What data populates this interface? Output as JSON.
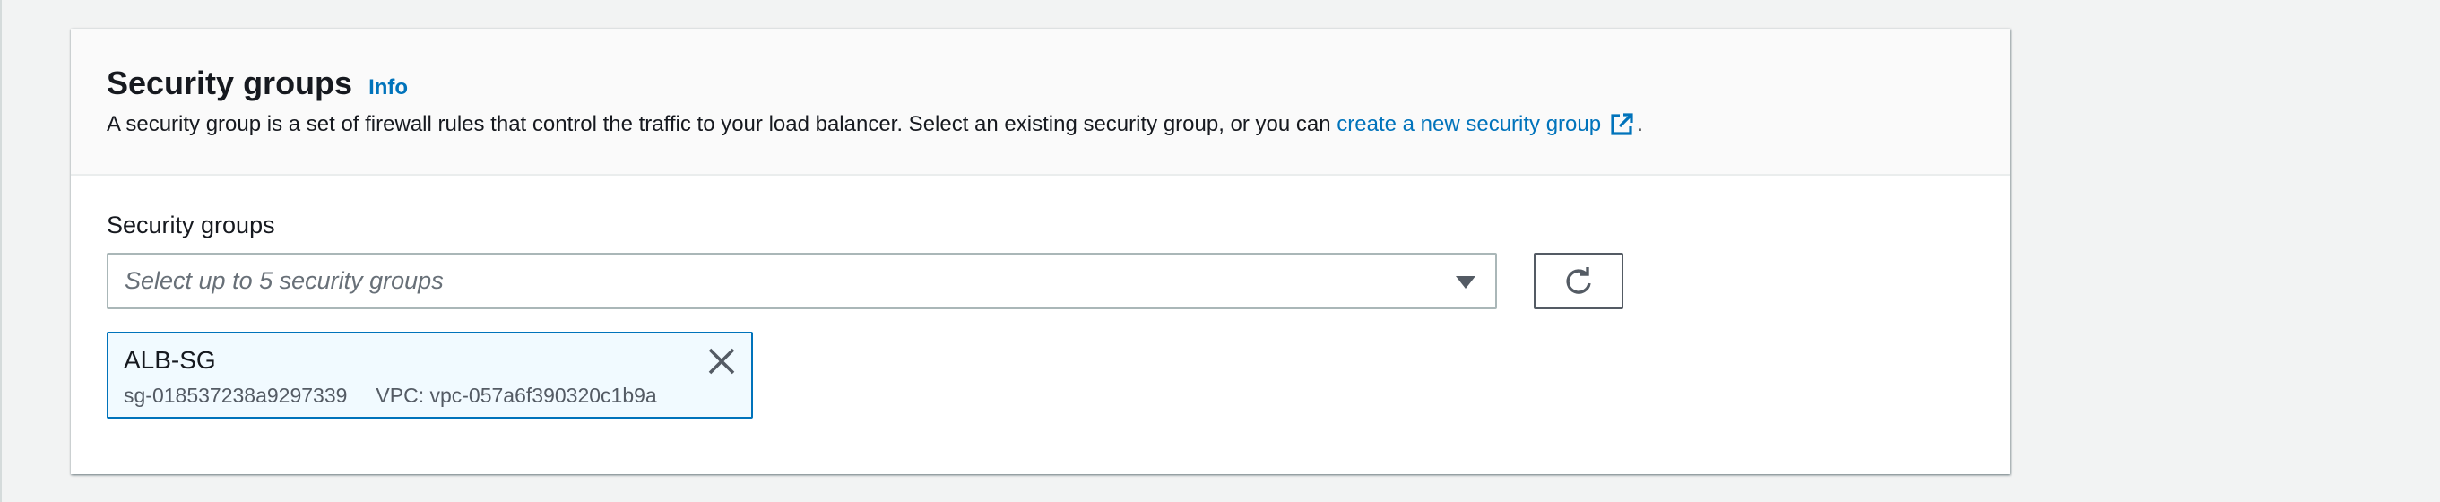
{
  "section": {
    "title": "Security groups",
    "info_label": "Info",
    "description_prefix": "A security group is a set of firewall rules that control the traffic to your load balancer. Select an existing security group, or you can ",
    "description_link": "create a new security group",
    "description_suffix": "."
  },
  "field": {
    "label": "Security groups",
    "placeholder": "Select up to 5 security groups"
  },
  "selected_group": {
    "name": "ALB-SG",
    "id": "sg-018537238a9297339",
    "vpc": "VPC: vpc-057a6f390320c1b9a"
  },
  "icons": {
    "external_link": "external-link-icon",
    "dropdown": "caret-down-icon",
    "refresh": "refresh-icon",
    "remove": "close-icon"
  },
  "colors": {
    "link": "#0073bb",
    "token_border": "#0073bb",
    "token_background": "#f1faff",
    "page_background": "#f2f3f3"
  }
}
